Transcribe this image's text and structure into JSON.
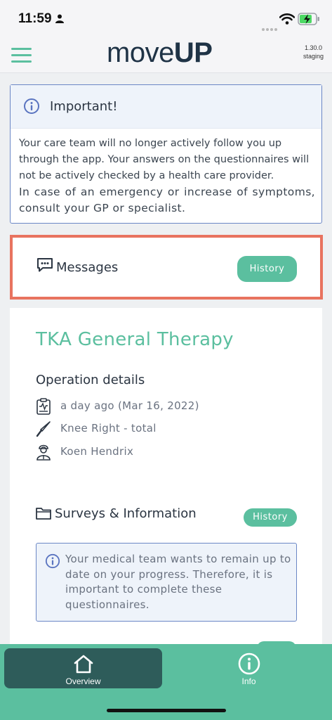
{
  "status_bar": {
    "time": "11:59",
    "icons": [
      "person-icon",
      "signal-dots-icon",
      "wifi-icon",
      "battery-charging-icon"
    ]
  },
  "header": {
    "logo_light": "move",
    "logo_bold": "UP",
    "version": "1.30.0",
    "environment": "staging"
  },
  "important": {
    "title": "Important!",
    "body": "Your care team will no longer actively follow you up through the app. Your answers on the questionnaires will not be actively checked by a health care provider.",
    "emphasis": "In case of an emergency or increase of symptoms, consult your GP or specialist."
  },
  "messages": {
    "title": "Messages",
    "history_label": "History"
  },
  "therapy": {
    "title": "TKA General Therapy",
    "operation_title": "Operation details",
    "date": "a day ago (Mar 16, 2022)",
    "procedure": "Knee Right - total",
    "surgeon": "Koen Hendrix"
  },
  "surveys": {
    "title": "Surveys & Information",
    "history_label": "History",
    "notice": "Your medical team wants to remain up to date on your progress. Therefore, it is important to complete these questionnaires."
  },
  "bottom_nav": {
    "overview_label": "Overview",
    "info_label": "Info"
  },
  "colors": {
    "accent": "#5bbf9f",
    "dark_tab": "#2e5c5a",
    "info_blue": "#6b87c6",
    "highlight": "#e8735f"
  }
}
